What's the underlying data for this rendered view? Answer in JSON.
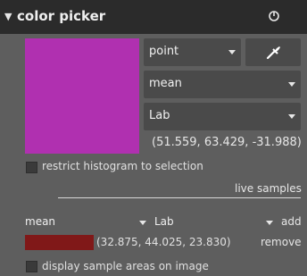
{
  "header": {
    "collapse_icon": "triangle-down-icon",
    "title": "color picker",
    "power_icon": "power-icon"
  },
  "picker": {
    "swatch_color": "#b030b0",
    "mode_value": "point",
    "statistic_value": "mean",
    "colorspace_value": "Lab",
    "eyedropper_icon": "eyedropper-icon",
    "readout": "(51.559, 63.429, -31.988)"
  },
  "restrict_histogram": {
    "label": "restrict histogram to selection",
    "checked": false
  },
  "live_samples": {
    "label": "live samples"
  },
  "sample_controls": {
    "statistic_value": "mean",
    "colorspace_value": "Lab",
    "add_label": "add"
  },
  "sample": {
    "swatch_color": "#801818",
    "values": "(32.875, 44.025, 23.830)",
    "remove_label": "remove"
  },
  "display_sample_areas": {
    "label": "display sample areas on image",
    "checked": false
  }
}
